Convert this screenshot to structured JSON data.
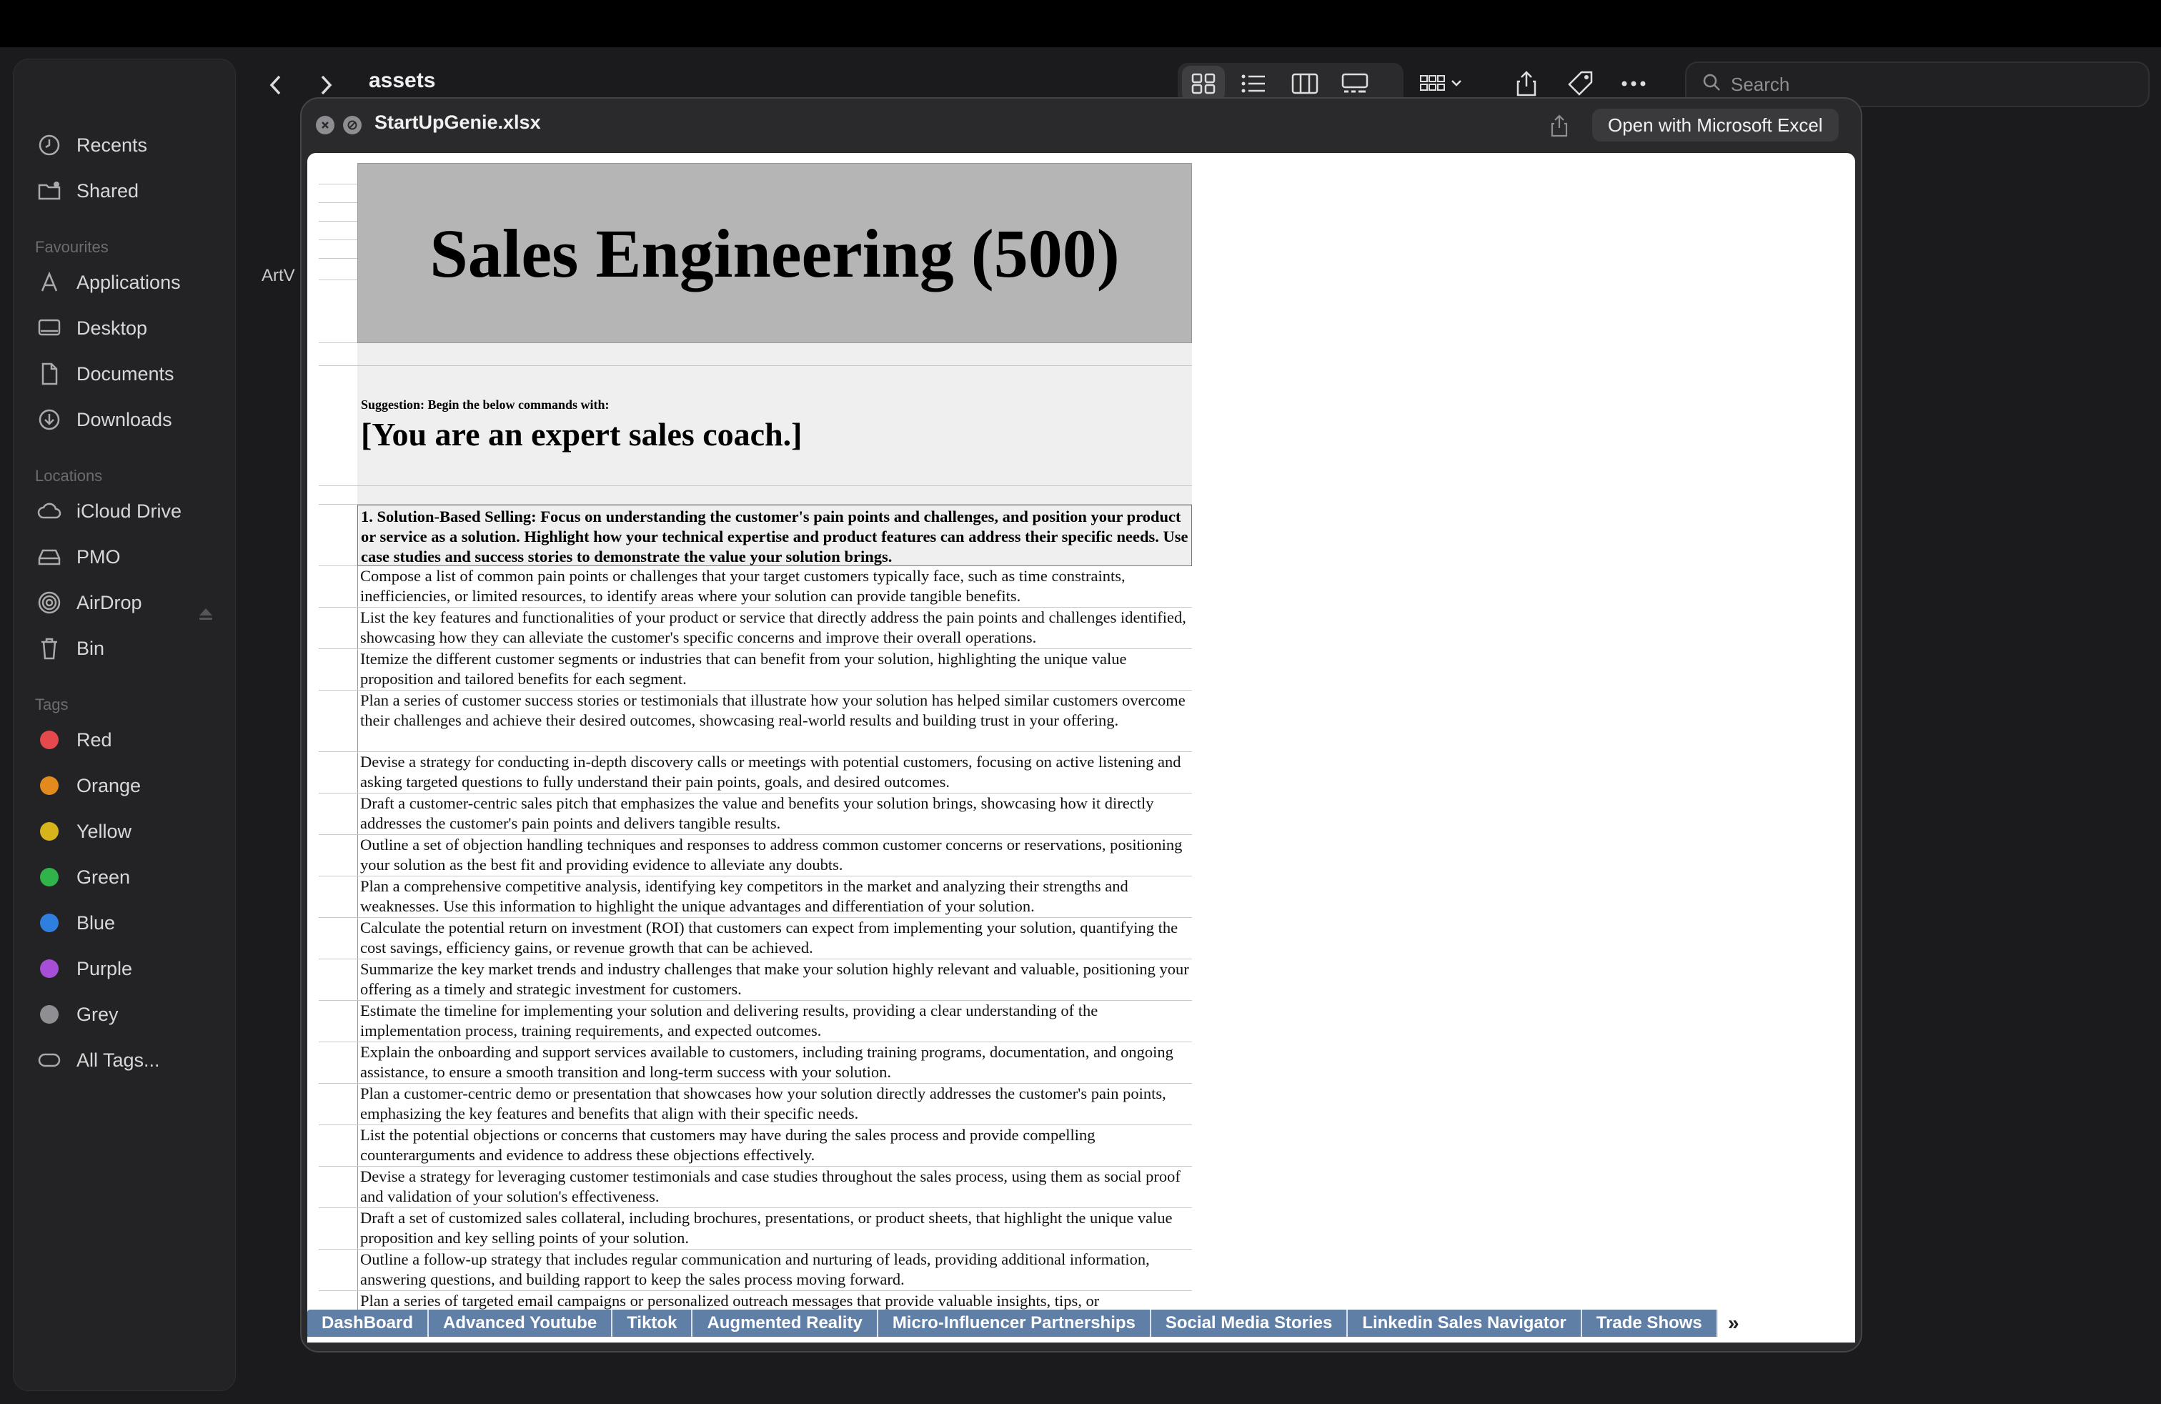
{
  "finder": {
    "folder_title": "assets",
    "search_placeholder": "Search",
    "partial_item_label": "ArtV"
  },
  "sidebar": {
    "top_items": [
      {
        "label": "Recents",
        "icon": "clock-icon"
      },
      {
        "label": "Shared",
        "icon": "shared-folder-icon"
      }
    ],
    "favourites_heading": "Favourites",
    "favourites": [
      {
        "label": "Applications",
        "icon": "applications-icon"
      },
      {
        "label": "Desktop",
        "icon": "desktop-icon"
      },
      {
        "label": "Documents",
        "icon": "document-icon"
      },
      {
        "label": "Downloads",
        "icon": "download-icon"
      }
    ],
    "locations_heading": "Locations",
    "locations": [
      {
        "label": "iCloud Drive",
        "icon": "cloud-icon"
      },
      {
        "label": "PMO",
        "icon": "drive-icon"
      },
      {
        "label": "AirDrop",
        "icon": "airdrop-icon"
      },
      {
        "label": "Bin",
        "icon": "trash-icon"
      }
    ],
    "tags_heading": "Tags",
    "tags": [
      {
        "label": "Red",
        "color": "#e5484d"
      },
      {
        "label": "Orange",
        "color": "#e38a1f"
      },
      {
        "label": "Yellow",
        "color": "#d8b41c"
      },
      {
        "label": "Green",
        "color": "#2fb34a"
      },
      {
        "label": "Blue",
        "color": "#2f7fe0"
      },
      {
        "label": "Purple",
        "color": "#a64fd6"
      },
      {
        "label": "Grey",
        "color": "#8e8e93"
      }
    ],
    "all_tags": "All Tags..."
  },
  "quicklook": {
    "filename": "StartUpGenie.xlsx",
    "open_button": "Open with Microsoft Excel"
  },
  "sheet": {
    "title": "Sales Engineering (500)",
    "suggestion_label": "Suggestion: Begin the below commands with:",
    "suggestion_text": "[You are an expert sales coach.]",
    "section_header": "1.  Solution-Based Selling: Focus on understanding the customer's pain points and challenges, and position your product or service as a solution. Highlight how your technical expertise and product features can address their specific needs. Use case studies and success stories to demonstrate the value your solution brings.",
    "rows": [
      "Compose a list of common pain points or challenges that your target customers typically face, such as time constraints, inefficiencies, or limited resources, to identify areas where your solution can provide tangible benefits.",
      "List the key features and functionalities of your product or service that directly address the pain points and challenges identified, showcasing how they can alleviate the customer's specific concerns and improve their overall operations.",
      "Itemize the different customer segments or industries that can benefit from your solution, highlighting the unique value proposition and tailored benefits for each segment.",
      "Plan a series of customer success stories or testimonials that illustrate how your solution has helped similar customers overcome their challenges and achieve their desired outcomes, showcasing real-world results and building trust in your offering.",
      "Devise a strategy for conducting in-depth discovery calls or meetings with potential customers, focusing on active listening and asking targeted questions to fully understand their pain points, goals, and desired outcomes.",
      "Draft a customer-centric sales pitch that emphasizes the value and benefits your solution brings, showcasing how it directly addresses the customer's pain points and delivers tangible results.",
      "Outline a set of objection handling techniques and responses to address common customer concerns or reservations, positioning your solution as the best fit and providing evidence to alleviate any doubts.",
      "Plan a comprehensive competitive analysis, identifying key competitors in the market and analyzing their strengths and weaknesses. Use this information to highlight the unique advantages and differentiation of your solution.",
      "Calculate the potential return on investment (ROI) that customers can expect from implementing your solution, quantifying the cost savings, efficiency gains, or revenue growth that can be achieved.",
      "Summarize the key market trends and industry challenges that make your solution highly relevant and valuable, positioning your offering as a timely and strategic investment for customers.",
      "Estimate the timeline for implementing your solution and delivering results, providing a clear understanding of the implementation process, training requirements, and expected outcomes.",
      "Explain the onboarding and support services available to customers, including training programs, documentation, and ongoing assistance, to ensure a smooth transition and long-term success with your solution.",
      "Plan a customer-centric demo or presentation that showcases how your solution directly addresses the customer's pain points, emphasizing the key features and benefits that align with their specific needs.",
      "List the potential objections or concerns that customers may have during the sales process and provide compelling counterarguments and evidence to address these objections effectively.",
      "Devise a strategy for leveraging customer testimonials and case studies throughout the sales process, using them as social proof and validation of your solution's effectiveness.",
      "Draft a set of customized sales collateral, including brochures, presentations, or product sheets, that highlight the unique value proposition and key selling points of your solution.",
      "Outline a follow-up strategy that includes regular communication and nurturing of leads, providing additional information, answering questions, and building rapport to keep the sales process moving forward.",
      "Plan a series of targeted email campaigns or personalized outreach messages that provide valuable insights, tips, or"
    ]
  },
  "tabs": [
    "DashBoard",
    "Advanced Youtube",
    "Tiktok",
    "Augmented Reality",
    "Micro-Influencer Partnerships",
    "Social Media Stories",
    "Linkedin Sales Navigator",
    "Trade Shows"
  ],
  "tabs_more": "»"
}
